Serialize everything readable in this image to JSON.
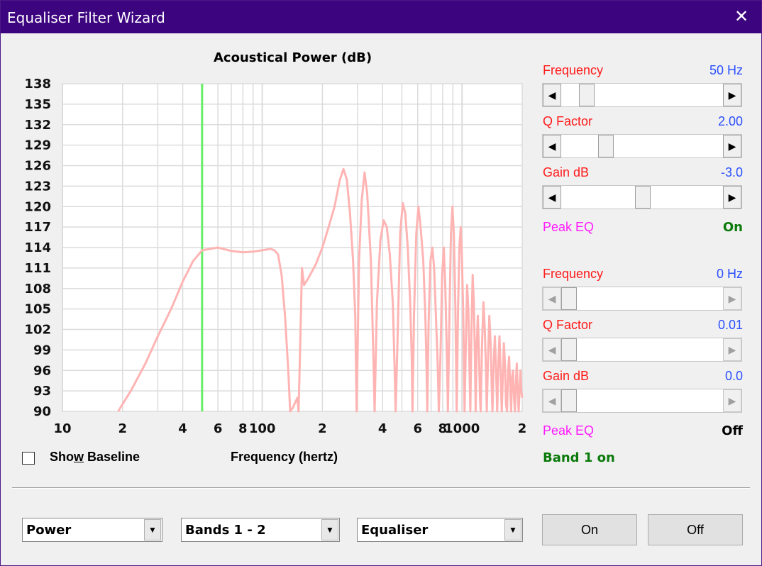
{
  "window": {
    "title": "Equaliser Filter Wizard",
    "close_symbol": "✕"
  },
  "chart_data": {
    "type": "line",
    "title": "Acoustical Power (dB)",
    "xlabel": "Frequency (hertz)",
    "ylabel": "",
    "x_scale": "log",
    "xlim": [
      10,
      2000
    ],
    "ylim": [
      90,
      138
    ],
    "y_ticks": [
      "138",
      "135",
      "132",
      "129",
      "126",
      "123",
      "120",
      "117",
      "114",
      "111",
      "108",
      "105",
      "102",
      "99",
      "96",
      "93",
      "90"
    ],
    "x_ticks": [
      {
        "v": 10,
        "label": "10"
      },
      {
        "v": 20,
        "label": "2"
      },
      {
        "v": 40,
        "label": "4"
      },
      {
        "v": 60,
        "label": "6"
      },
      {
        "v": 80,
        "label": "8"
      },
      {
        "v": 100,
        "label": "100"
      },
      {
        "v": 200,
        "label": "2"
      },
      {
        "v": 400,
        "label": "4"
      },
      {
        "v": 600,
        "label": "6"
      },
      {
        "v": 800,
        "label": "8"
      },
      {
        "v": 1000,
        "label": "1000"
      },
      {
        "v": 2000,
        "label": "2"
      }
    ],
    "marker_frequency": 50,
    "colors": {
      "curve": "#ffb4b4",
      "marker": "#66ee66",
      "grid": "#dcdcdc",
      "plot_bg": "#ffffff"
    },
    "series": [
      {
        "points": [
          [
            19,
            90
          ],
          [
            22,
            93
          ],
          [
            26,
            97
          ],
          [
            30,
            101
          ],
          [
            35,
            105
          ],
          [
            40,
            109
          ],
          [
            45,
            112
          ],
          [
            50,
            113.6
          ],
          [
            60,
            114
          ],
          [
            70,
            113.5
          ],
          [
            80,
            113.3
          ],
          [
            90,
            113.4
          ],
          [
            100,
            113.6
          ],
          [
            110,
            113.8
          ],
          [
            115,
            113.6
          ],
          [
            120,
            113
          ],
          [
            125,
            110
          ],
          [
            130,
            104
          ],
          [
            135,
            96
          ],
          [
            138,
            90
          ],
          [
            142,
            90.5
          ],
          [
            150,
            92
          ],
          [
            152,
            90
          ],
          [
            155,
            100
          ],
          [
            158,
            111
          ],
          [
            162,
            108.5
          ],
          [
            170,
            109.5
          ],
          [
            185,
            111.5
          ],
          [
            200,
            114
          ],
          [
            215,
            117
          ],
          [
            230,
            120
          ],
          [
            245,
            124
          ],
          [
            255,
            125.5
          ],
          [
            265,
            124
          ],
          [
            275,
            119
          ],
          [
            285,
            112
          ],
          [
            292,
            104
          ],
          [
            297,
            90
          ],
          [
            305,
            112
          ],
          [
            315,
            121
          ],
          [
            325,
            125
          ],
          [
            335,
            122
          ],
          [
            350,
            112
          ],
          [
            360,
            98
          ],
          [
            365,
            90
          ],
          [
            375,
            106
          ],
          [
            390,
            115
          ],
          [
            405,
            118
          ],
          [
            420,
            117
          ],
          [
            435,
            113
          ],
          [
            450,
            106
          ],
          [
            460,
            96
          ],
          [
            465,
            90
          ],
          [
            475,
            100
          ],
          [
            490,
            116
          ],
          [
            505,
            120.5
          ],
          [
            520,
            119
          ],
          [
            535,
            114
          ],
          [
            550,
            106
          ],
          [
            560,
            98
          ],
          [
            565,
            90
          ],
          [
            575,
            104
          ],
          [
            590,
            116
          ],
          [
            605,
            120
          ],
          [
            620,
            117
          ],
          [
            640,
            112
          ],
          [
            655,
            104
          ],
          [
            665,
            96
          ],
          [
            670,
            90
          ],
          [
            680,
            103
          ],
          [
            695,
            112
          ],
          [
            710,
            114
          ],
          [
            725,
            111
          ],
          [
            740,
            104
          ],
          [
            755,
            97
          ],
          [
            765,
            90
          ],
          [
            780,
            98
          ],
          [
            795,
            110
          ],
          [
            810,
            114
          ],
          [
            825,
            108
          ],
          [
            840,
            98
          ],
          [
            850,
            90
          ],
          [
            865,
            104
          ],
          [
            880,
            116
          ],
          [
            895,
            120
          ],
          [
            910,
            116
          ],
          [
            925,
            106
          ],
          [
            935,
            96
          ],
          [
            940,
            90
          ],
          [
            955,
            105
          ],
          [
            970,
            114
          ],
          [
            985,
            117
          ],
          [
            1000,
            112
          ],
          [
            1015,
            104
          ],
          [
            1025,
            94
          ],
          [
            1030,
            90
          ],
          [
            1045,
            100
          ],
          [
            1060,
            108.5
          ],
          [
            1075,
            105
          ],
          [
            1090,
            96
          ],
          [
            1100,
            90
          ],
          [
            1115,
            102
          ],
          [
            1130,
            110
          ],
          [
            1145,
            106
          ],
          [
            1160,
            98
          ],
          [
            1170,
            90
          ],
          [
            1185,
            100
          ],
          [
            1200,
            104
          ],
          [
            1215,
            99
          ],
          [
            1230,
            92
          ],
          [
            1240,
            90
          ],
          [
            1260,
            100
          ],
          [
            1280,
            106
          ],
          [
            1300,
            102
          ],
          [
            1320,
            95
          ],
          [
            1330,
            90
          ],
          [
            1350,
            98
          ],
          [
            1370,
            104
          ],
          [
            1390,
            100
          ],
          [
            1410,
            93
          ],
          [
            1420,
            90
          ],
          [
            1440,
            97
          ],
          [
            1460,
            101
          ],
          [
            1480,
            96
          ],
          [
            1500,
            90
          ],
          [
            1520,
            97
          ],
          [
            1540,
            101
          ],
          [
            1560,
            96
          ],
          [
            1580,
            90
          ],
          [
            1600,
            95
          ],
          [
            1620,
            100
          ],
          [
            1640,
            97
          ],
          [
            1660,
            91
          ],
          [
            1680,
            90
          ],
          [
            1700,
            96
          ],
          [
            1720,
            98
          ],
          [
            1740,
            94
          ],
          [
            1760,
            90
          ],
          [
            1780,
            95
          ],
          [
            1800,
            96
          ],
          [
            1820,
            92
          ],
          [
            1840,
            90
          ],
          [
            1860,
            94
          ],
          [
            1880,
            97
          ],
          [
            1900,
            93
          ],
          [
            1920,
            90
          ],
          [
            1940,
            93
          ],
          [
            1960,
            96
          ],
          [
            1980,
            93
          ],
          [
            2000,
            92
          ]
        ]
      }
    ]
  },
  "show_baseline": {
    "label_before": "Sho",
    "label_mnemonic": "w",
    "label_after": " Baseline",
    "checked": false
  },
  "band1": {
    "frequency": {
      "label": "Frequency",
      "value": "50 Hz",
      "position": 0.12
    },
    "q_factor": {
      "label": "Q Factor",
      "value": "2.00",
      "position": 0.25
    },
    "gain": {
      "label": "Gain  dB",
      "value": "-3.0",
      "position": 0.5
    },
    "peak_eq": {
      "label": "Peak EQ",
      "value": "On"
    }
  },
  "band2": {
    "frequency": {
      "label": "Frequency",
      "value": "0 Hz",
      "position": 0
    },
    "q_factor": {
      "label": "Q Factor",
      "value": "0.01",
      "position": 0
    },
    "gain": {
      "label": "Gain  dB",
      "value": "0.0",
      "position": 0
    },
    "peak_eq": {
      "label": "Peak EQ",
      "value": "Off"
    }
  },
  "status": "Band 1 on",
  "controls": {
    "view_select": "Power",
    "bands_select": "Bands 1 - 2",
    "type_select": "Equaliser",
    "on_button": "On",
    "off_button": "Off",
    "combo_arrow": "▼"
  }
}
